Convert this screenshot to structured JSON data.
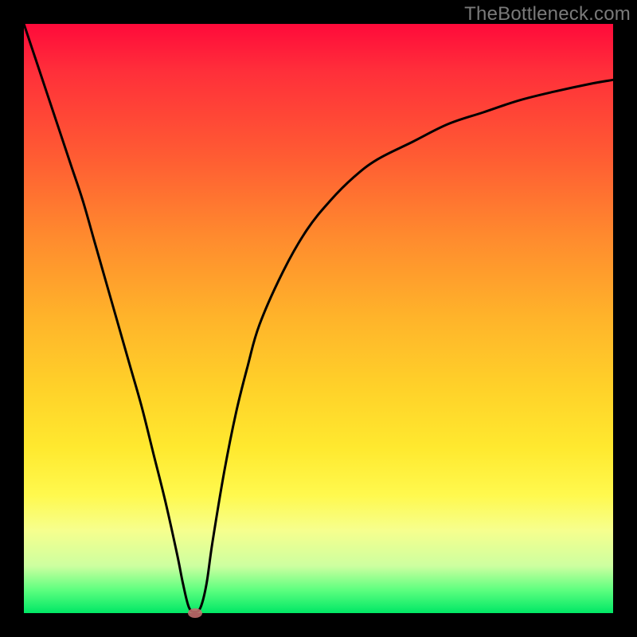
{
  "watermark": "TheBottleneck.com",
  "chart_data": {
    "type": "line",
    "title": "",
    "xlabel": "",
    "ylabel": "",
    "xlim": [
      0,
      100
    ],
    "ylim": [
      0,
      100
    ],
    "grid": false,
    "background_gradient": {
      "top": "#ff0a3a",
      "bottom": "#00e765"
    },
    "series": [
      {
        "name": "bottleneck-curve",
        "color": "#000000",
        "x": [
          0,
          2,
          4,
          6,
          8,
          10,
          12,
          14,
          16,
          18,
          20,
          22,
          24,
          26,
          27,
          28,
          29,
          30,
          31,
          32,
          34,
          36,
          38,
          40,
          44,
          48,
          52,
          56,
          60,
          66,
          72,
          78,
          84,
          90,
          96,
          100
        ],
        "y": [
          100,
          94,
          88,
          82,
          76,
          70,
          63,
          56,
          49,
          42,
          35,
          27,
          19,
          10,
          5,
          1,
          0.2,
          1,
          5,
          12,
          24,
          34,
          42,
          49,
          58,
          65,
          70,
          74,
          77,
          80,
          83,
          85,
          87,
          88.5,
          89.8,
          90.5
        ]
      }
    ],
    "annotations": [
      {
        "name": "minimum-marker",
        "shape": "ellipse",
        "color": "#c46e6e",
        "x": 29,
        "y": 0
      }
    ]
  }
}
